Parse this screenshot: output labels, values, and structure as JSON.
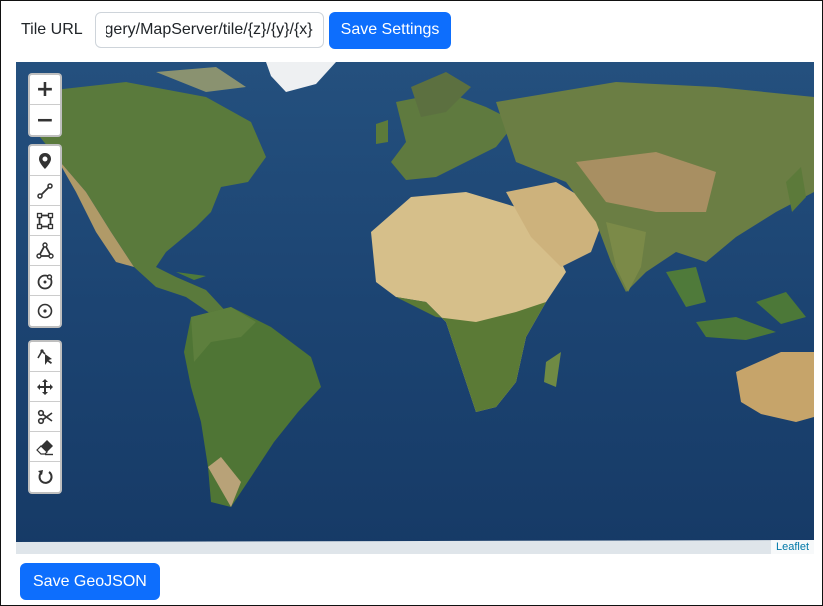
{
  "toolbar": {
    "tile_url_label": "Tile URL",
    "tile_url_value": "https://server.arcgisonline.com/ArcGIS/rest/services/World_Imagery/MapServer/tile/{z}/{y}/{x}",
    "save_settings_label": "Save Settings"
  },
  "map": {
    "zoom_in_label": "+",
    "zoom_out_label": "−",
    "draw_tools": [
      "marker-icon",
      "polyline-icon",
      "rectangle-icon",
      "polygon-icon",
      "circle-icon",
      "circle-marker-icon"
    ],
    "edit_tools": [
      "edit-layers-icon",
      "drag-icon",
      "cut-icon",
      "eraser-icon",
      "rotate-icon"
    ],
    "attribution": "Leaflet",
    "colors": {
      "ocean": "#1c4472",
      "land": "#5c7a3a",
      "desert": "#d6bf8a",
      "ice": "#f2f4f5"
    }
  },
  "footer": {
    "save_geojson_label": "Save GeoJSON"
  }
}
